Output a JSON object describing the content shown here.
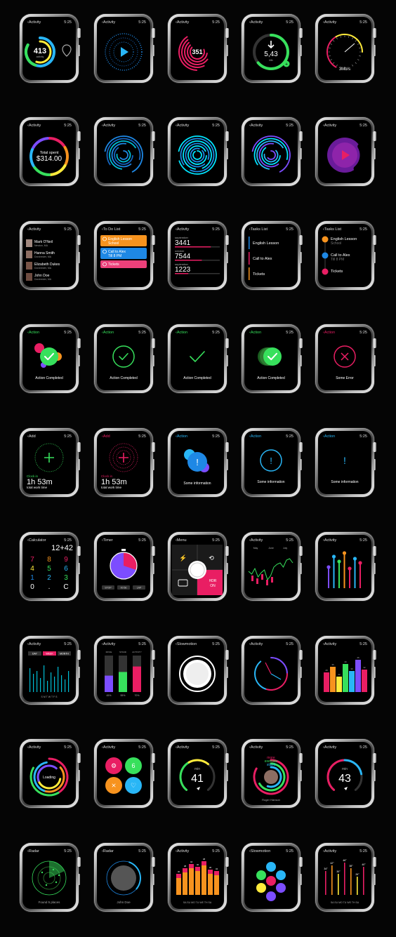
{
  "time": "5:25",
  "screens": [
    {
      "title": "Activity",
      "back": "‹",
      "title_color": "#dddddd",
      "kind": "ring-activity",
      "value": "413",
      "sub": "activity"
    },
    {
      "title": "Activity",
      "back": "‹",
      "title_color": "#dddddd",
      "kind": "play-dots"
    },
    {
      "title": "Activity",
      "back": "‹",
      "title_color": "#dddddd",
      "kind": "pink-rings",
      "value": "351"
    },
    {
      "title": "Activity",
      "back": "‹",
      "title_color": "#dddddd",
      "kind": "download",
      "value": "5,43",
      "sub": "Mb"
    },
    {
      "title": "Activity",
      "back": "‹",
      "title_color": "#dddddd",
      "kind": "speed",
      "value": "3Mb/s"
    },
    {
      "title": "Activity",
      "back": "‹",
      "title_color": "#dddddd",
      "kind": "total-spent",
      "label": "Total spent",
      "value": "$314.00"
    },
    {
      "title": "Activity",
      "back": "‹",
      "title_color": "#dddddd",
      "kind": "conc-a"
    },
    {
      "title": "Activity",
      "back": "‹",
      "title_color": "#dddddd",
      "kind": "conc-b"
    },
    {
      "title": "Activity",
      "back": "‹",
      "title_color": "#dddddd",
      "kind": "conc-c"
    },
    {
      "title": "Activity",
      "back": "‹",
      "title_color": "#dddddd",
      "kind": "disc-play"
    },
    {
      "title": "Activity",
      "back": "‹",
      "title_color": "#dddddd",
      "kind": "contacts",
      "contacts": [
        {
          "name": "Mark O'Neil",
          "place": "Newton, MA"
        },
        {
          "name": "Hanna Smith",
          "place": "Dorchester, MA"
        },
        {
          "name": "Elizabeth Dukes",
          "place": "Dorchester, MA"
        },
        {
          "name": "John Doe",
          "place": "Dorchester, MA"
        }
      ]
    },
    {
      "title": "To Do List",
      "back": "‹",
      "title_color": "#dddddd",
      "kind": "todo",
      "items": [
        {
          "text": "English Lesson",
          "sub": "School",
          "color": "#f7931e"
        },
        {
          "text": "Call to Alex",
          "sub": "Till 8 PM",
          "color": "#1e88e5"
        },
        {
          "text": "Tickets",
          "sub": "",
          "color": "#ec407a"
        }
      ]
    },
    {
      "title": "Activity",
      "back": "‹",
      "title_color": "#dddddd",
      "kind": "months",
      "rows": [
        {
          "month": "september",
          "value": "3441",
          "color": "#e91e63",
          "fill": 0.8
        },
        {
          "month": "october",
          "value": "7544",
          "color": "#e91e63",
          "fill": 0.6
        },
        {
          "month": "september",
          "value": "1223",
          "color": "#e91e63",
          "fill": 0.3
        }
      ]
    },
    {
      "title": "Tasks List",
      "back": "‹",
      "title_color": "#dddddd",
      "kind": "tasks",
      "items": [
        {
          "text": "English Lesson",
          "color": "#1e88e5"
        },
        {
          "text": "Call to Alex",
          "color": "#e91e63"
        },
        {
          "text": "Tickets",
          "color": "#f7931e"
        }
      ]
    },
    {
      "title": "Tasks List",
      "back": "‹",
      "title_color": "#dddddd",
      "kind": "timeline",
      "items": [
        {
          "text": "English Lesson",
          "sub": "School",
          "color": "#f7931e"
        },
        {
          "text": "Call to Alex",
          "sub": "Till 8 PM",
          "color": "#1e88e5"
        },
        {
          "text": "Tickets",
          "sub": "",
          "color": "#e91e63"
        }
      ]
    },
    {
      "title": "Action",
      "back": "‹",
      "title_color": "#37e05c",
      "kind": "done-bubbles",
      "label": "Action Completed"
    },
    {
      "title": "Action",
      "back": "‹",
      "title_color": "#37e05c",
      "kind": "done-ring",
      "label": "Action Completed"
    },
    {
      "title": "Action",
      "back": "‹",
      "title_color": "#37e05c",
      "kind": "done-plain",
      "label": "Action Completed"
    },
    {
      "title": "Action",
      "back": "‹",
      "title_color": "#37e05c",
      "kind": "done-stack",
      "label": "Action Completed"
    },
    {
      "title": "Action",
      "back": "‹",
      "title_color": "#e91e63",
      "kind": "error",
      "label": "Some Error"
    },
    {
      "title": "Add",
      "back": "‹",
      "title_color": "#dddddd",
      "kind": "add-green",
      "clock": "Clock in",
      "value": "1h 53m",
      "sub": "total work time"
    },
    {
      "title": "Add",
      "back": "‹",
      "title_color": "#e91e63",
      "kind": "add-pink",
      "clock": "Clock in",
      "value": "1h 53m",
      "sub": "total work time"
    },
    {
      "title": "Action",
      "back": "‹",
      "title_color": "#29b6f6",
      "kind": "info-bubbles",
      "label": "Some information"
    },
    {
      "title": "Action",
      "back": "‹",
      "title_color": "#29b6f6",
      "kind": "info-ring",
      "label": "Some information"
    },
    {
      "title": "Action",
      "back": "‹",
      "title_color": "#29b6f6",
      "kind": "info-plain",
      "label": "Some information"
    },
    {
      "title": "Calculator",
      "back": "‹",
      "title_color": "#dddddd",
      "kind": "calculator",
      "value": "12+42",
      "keys": [
        "7",
        "8",
        "9",
        "4",
        "5",
        "6",
        "1",
        "2",
        "3",
        "0",
        ".",
        "C"
      ]
    },
    {
      "title": "Timer",
      "back": "‹",
      "title_color": "#dddddd",
      "kind": "timer",
      "buttons": [
        "STOP",
        "00:56",
        "LAP"
      ]
    },
    {
      "title": "Menu",
      "back": "‹",
      "title_color": "#dddddd",
      "kind": "camera",
      "label": "HDR ON"
    },
    {
      "title": "Activity",
      "back": "‹",
      "title_color": "#dddddd",
      "kind": "stock"
    },
    {
      "title": "Activity",
      "back": "‹",
      "title_color": "#dddddd",
      "kind": "spikes"
    },
    {
      "title": "Activity",
      "back": "‹",
      "title_color": "#dddddd",
      "kind": "lines",
      "tabs": [
        "DAY",
        "WEEK",
        "MONTH"
      ],
      "days": "S M T W T F S"
    },
    {
      "title": "Activity",
      "back": "‹",
      "title_color": "#dddddd",
      "kind": "tri-bars",
      "bars": [
        {
          "label": "MOVE",
          "color": "#7c4dff",
          "fill": 0.45,
          "value": "45%"
        },
        {
          "label": "STAND",
          "color": "#37e05c",
          "fill": 0.55,
          "value": "55%"
        },
        {
          "label": "ACTIVITY",
          "color": "#e91e63",
          "fill": 0.7,
          "value": "70%"
        }
      ]
    },
    {
      "title": "Slowmotion",
      "back": "‹",
      "title_color": "#dddddd",
      "kind": "slowmo"
    },
    {
      "title": "Activity",
      "back": "‹",
      "title_color": "#dddddd",
      "kind": "neon-clock"
    },
    {
      "title": "Activity",
      "back": "‹",
      "title_color": "#dddddd",
      "kind": "color-bars"
    },
    {
      "title": "Activity",
      "back": "‹",
      "title_color": "#dddddd",
      "kind": "loading",
      "label": "Loading"
    },
    {
      "title": "Activity",
      "back": "‹",
      "title_color": "#dddddd",
      "kind": "four-buttons"
    },
    {
      "title": "Activity",
      "back": "‹",
      "title_color": "#dddddd",
      "kind": "gauge",
      "unit": "min",
      "value": "41"
    },
    {
      "title": "Activity",
      "back": "‹",
      "title_color": "#dddddd",
      "kind": "profile",
      "lines": [
        "more",
        "exercise",
        "stand"
      ],
      "name": "Roger Hanson"
    },
    {
      "title": "Activity",
      "back": "‹",
      "title_color": "#dddddd",
      "kind": "gauge2",
      "unit": "min",
      "value": "43"
    },
    {
      "title": "Radar",
      "back": "‹",
      "title_color": "#dddddd",
      "kind": "radar-green",
      "label": "Found 5 places"
    },
    {
      "title": "Radar",
      "back": "‹",
      "title_color": "#dddddd",
      "kind": "radar-person",
      "label": "John Doe"
    },
    {
      "title": "Activity",
      "back": "‹",
      "title_color": "#dddddd",
      "kind": "orange-bars",
      "days": "SA SU MO TU WE TH SA"
    },
    {
      "title": "Slowmotion",
      "back": "‹",
      "title_color": "#dddddd",
      "kind": "dot-menu"
    },
    {
      "title": "Activity",
      "back": "‹",
      "title_color": "#dddddd",
      "kind": "weather",
      "days": "SA SU MO TU WE TH SA"
    }
  ],
  "colors": {
    "green": "#37e05c",
    "pink": "#e91e63",
    "blue": "#29b6f6",
    "orange": "#f7931e"
  }
}
